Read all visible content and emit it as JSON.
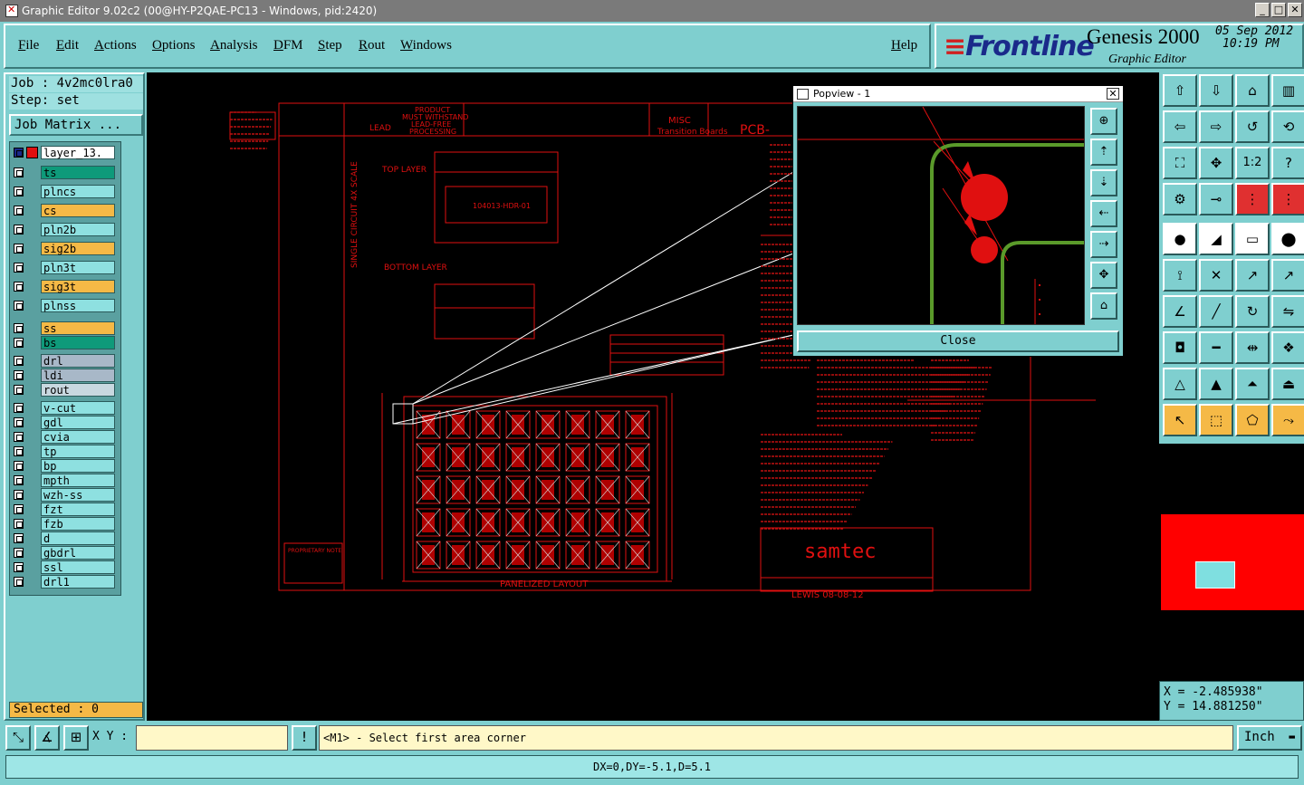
{
  "window": {
    "title": "Graphic Editor 9.02c2 (00@HY-P2QAE-PC13 - Windows, pid:2420)"
  },
  "menu": {
    "items": [
      "File",
      "Edit",
      "Actions",
      "Options",
      "Analysis",
      "DFM",
      "Step",
      "Rout",
      "Windows"
    ],
    "help": "Help"
  },
  "brand": {
    "logo": "Frontline",
    "product": "Genesis 2000",
    "subtitle": "Graphic Editor",
    "date": "05 Sep 2012",
    "time": "10:19 PM"
  },
  "left": {
    "job": "Job : 4v2mc0lra0",
    "step": "Step: set",
    "job_matrix": "Job Matrix ...",
    "layers": [
      {
        "name": "layer_13.",
        "color": "#ffffff"
      },
      {
        "name": "ts",
        "color": "#0e9a7a"
      },
      {
        "name": "plncs",
        "color": "#8ee0e0"
      },
      {
        "name": "cs",
        "color": "#f5b946"
      },
      {
        "name": "pln2b",
        "color": "#8ee0e0"
      },
      {
        "name": "sig2b",
        "color": "#f5b946"
      },
      {
        "name": "pln3t",
        "color": "#8ee0e0"
      },
      {
        "name": "sig3t",
        "color": "#f5b946"
      },
      {
        "name": "plnss",
        "color": "#8ee0e0"
      },
      {
        "name": "ss",
        "color": "#f5b946"
      },
      {
        "name": "bs",
        "color": "#0e9a7a"
      },
      {
        "name": "drl",
        "color": "#a8b8c8"
      },
      {
        "name": "ldi",
        "color": "#a8b8c8"
      },
      {
        "name": "rout",
        "color": "#c8d8e0"
      },
      {
        "name": "v-cut",
        "color": "#8ee0e0"
      },
      {
        "name": "gdl",
        "color": "#8ee0e0"
      },
      {
        "name": "cvia",
        "color": "#8ee0e0"
      },
      {
        "name": "tp",
        "color": "#8ee0e0"
      },
      {
        "name": "bp",
        "color": "#8ee0e0"
      },
      {
        "name": "mpth",
        "color": "#8ee0e0"
      },
      {
        "name": "wzh-ss",
        "color": "#8ee0e0"
      },
      {
        "name": "fzt",
        "color": "#8ee0e0"
      },
      {
        "name": "fzb",
        "color": "#8ee0e0"
      },
      {
        "name": "d",
        "color": "#8ee0e0"
      },
      {
        "name": "gbdrl",
        "color": "#8ee0e0"
      },
      {
        "name": "ssl",
        "color": "#8ee0e0"
      },
      {
        "name": "drl1",
        "color": "#8ee0e0"
      }
    ],
    "selected": "Selected : 0"
  },
  "drawing": {
    "top_layer": "TOP LAYER",
    "bottom_layer": "BOTTOM LAYER",
    "single_circuit": "SINGLE CIRCUIT 4X SCALE",
    "panelized": "PANELIZED LAYOUT",
    "samtec": "samtec",
    "part_no": "104013-HDR-01",
    "lewis": "LEWIS 08-08-12",
    "product_note": "PRODUCT MUST WITHSTAND LEAD-FREE PROCESSING",
    "misc": "MISC",
    "transition": "Transition Boards",
    "pcb": "PCB-",
    "lead": "LEAD",
    "proprietary": "PROPRIETARY NOTE"
  },
  "popview": {
    "title": "Popview - 1",
    "close": "Close"
  },
  "coords": {
    "x": "X = -2.485938\"",
    "y": "Y = 14.881250\""
  },
  "bottom": {
    "xy_label": "X Y :",
    "xy_value": "",
    "prompt": "<M1> - Select first area corner",
    "unit": "Inch",
    "status": "DX=0,DY=-5.1,D=5.1"
  }
}
